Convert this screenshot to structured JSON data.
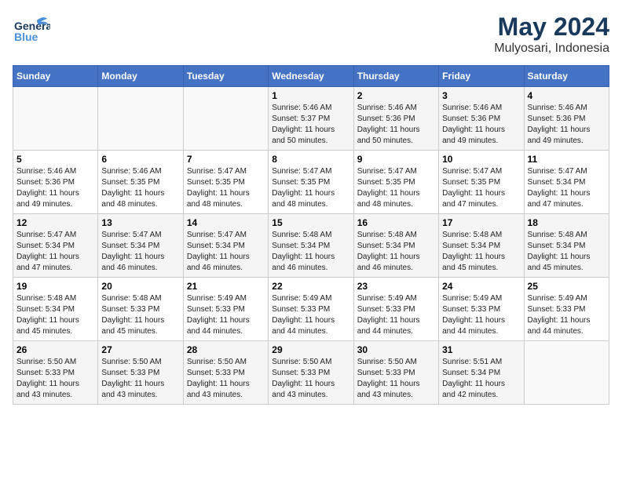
{
  "header": {
    "logo_general": "General",
    "logo_blue": "Blue",
    "title": "May 2024",
    "subtitle": "Mulyosari, Indonesia"
  },
  "weekdays": [
    "Sunday",
    "Monday",
    "Tuesday",
    "Wednesday",
    "Thursday",
    "Friday",
    "Saturday"
  ],
  "weeks": [
    [
      {
        "day": "",
        "info": ""
      },
      {
        "day": "",
        "info": ""
      },
      {
        "day": "",
        "info": ""
      },
      {
        "day": "1",
        "info": "Sunrise: 5:46 AM\nSunset: 5:37 PM\nDaylight: 11 hours\nand 50 minutes."
      },
      {
        "day": "2",
        "info": "Sunrise: 5:46 AM\nSunset: 5:36 PM\nDaylight: 11 hours\nand 50 minutes."
      },
      {
        "day": "3",
        "info": "Sunrise: 5:46 AM\nSunset: 5:36 PM\nDaylight: 11 hours\nand 49 minutes."
      },
      {
        "day": "4",
        "info": "Sunrise: 5:46 AM\nSunset: 5:36 PM\nDaylight: 11 hours\nand 49 minutes."
      }
    ],
    [
      {
        "day": "5",
        "info": "Sunrise: 5:46 AM\nSunset: 5:36 PM\nDaylight: 11 hours\nand 49 minutes."
      },
      {
        "day": "6",
        "info": "Sunrise: 5:46 AM\nSunset: 5:35 PM\nDaylight: 11 hours\nand 48 minutes."
      },
      {
        "day": "7",
        "info": "Sunrise: 5:47 AM\nSunset: 5:35 PM\nDaylight: 11 hours\nand 48 minutes."
      },
      {
        "day": "8",
        "info": "Sunrise: 5:47 AM\nSunset: 5:35 PM\nDaylight: 11 hours\nand 48 minutes."
      },
      {
        "day": "9",
        "info": "Sunrise: 5:47 AM\nSunset: 5:35 PM\nDaylight: 11 hours\nand 48 minutes."
      },
      {
        "day": "10",
        "info": "Sunrise: 5:47 AM\nSunset: 5:35 PM\nDaylight: 11 hours\nand 47 minutes."
      },
      {
        "day": "11",
        "info": "Sunrise: 5:47 AM\nSunset: 5:34 PM\nDaylight: 11 hours\nand 47 minutes."
      }
    ],
    [
      {
        "day": "12",
        "info": "Sunrise: 5:47 AM\nSunset: 5:34 PM\nDaylight: 11 hours\nand 47 minutes."
      },
      {
        "day": "13",
        "info": "Sunrise: 5:47 AM\nSunset: 5:34 PM\nDaylight: 11 hours\nand 46 minutes."
      },
      {
        "day": "14",
        "info": "Sunrise: 5:47 AM\nSunset: 5:34 PM\nDaylight: 11 hours\nand 46 minutes."
      },
      {
        "day": "15",
        "info": "Sunrise: 5:48 AM\nSunset: 5:34 PM\nDaylight: 11 hours\nand 46 minutes."
      },
      {
        "day": "16",
        "info": "Sunrise: 5:48 AM\nSunset: 5:34 PM\nDaylight: 11 hours\nand 46 minutes."
      },
      {
        "day": "17",
        "info": "Sunrise: 5:48 AM\nSunset: 5:34 PM\nDaylight: 11 hours\nand 45 minutes."
      },
      {
        "day": "18",
        "info": "Sunrise: 5:48 AM\nSunset: 5:34 PM\nDaylight: 11 hours\nand 45 minutes."
      }
    ],
    [
      {
        "day": "19",
        "info": "Sunrise: 5:48 AM\nSunset: 5:34 PM\nDaylight: 11 hours\nand 45 minutes."
      },
      {
        "day": "20",
        "info": "Sunrise: 5:48 AM\nSunset: 5:33 PM\nDaylight: 11 hours\nand 45 minutes."
      },
      {
        "day": "21",
        "info": "Sunrise: 5:49 AM\nSunset: 5:33 PM\nDaylight: 11 hours\nand 44 minutes."
      },
      {
        "day": "22",
        "info": "Sunrise: 5:49 AM\nSunset: 5:33 PM\nDaylight: 11 hours\nand 44 minutes."
      },
      {
        "day": "23",
        "info": "Sunrise: 5:49 AM\nSunset: 5:33 PM\nDaylight: 11 hours\nand 44 minutes."
      },
      {
        "day": "24",
        "info": "Sunrise: 5:49 AM\nSunset: 5:33 PM\nDaylight: 11 hours\nand 44 minutes."
      },
      {
        "day": "25",
        "info": "Sunrise: 5:49 AM\nSunset: 5:33 PM\nDaylight: 11 hours\nand 44 minutes."
      }
    ],
    [
      {
        "day": "26",
        "info": "Sunrise: 5:50 AM\nSunset: 5:33 PM\nDaylight: 11 hours\nand 43 minutes."
      },
      {
        "day": "27",
        "info": "Sunrise: 5:50 AM\nSunset: 5:33 PM\nDaylight: 11 hours\nand 43 minutes."
      },
      {
        "day": "28",
        "info": "Sunrise: 5:50 AM\nSunset: 5:33 PM\nDaylight: 11 hours\nand 43 minutes."
      },
      {
        "day": "29",
        "info": "Sunrise: 5:50 AM\nSunset: 5:33 PM\nDaylight: 11 hours\nand 43 minutes."
      },
      {
        "day": "30",
        "info": "Sunrise: 5:50 AM\nSunset: 5:33 PM\nDaylight: 11 hours\nand 43 minutes."
      },
      {
        "day": "31",
        "info": "Sunrise: 5:51 AM\nSunset: 5:34 PM\nDaylight: 11 hours\nand 42 minutes."
      },
      {
        "day": "",
        "info": ""
      }
    ]
  ]
}
